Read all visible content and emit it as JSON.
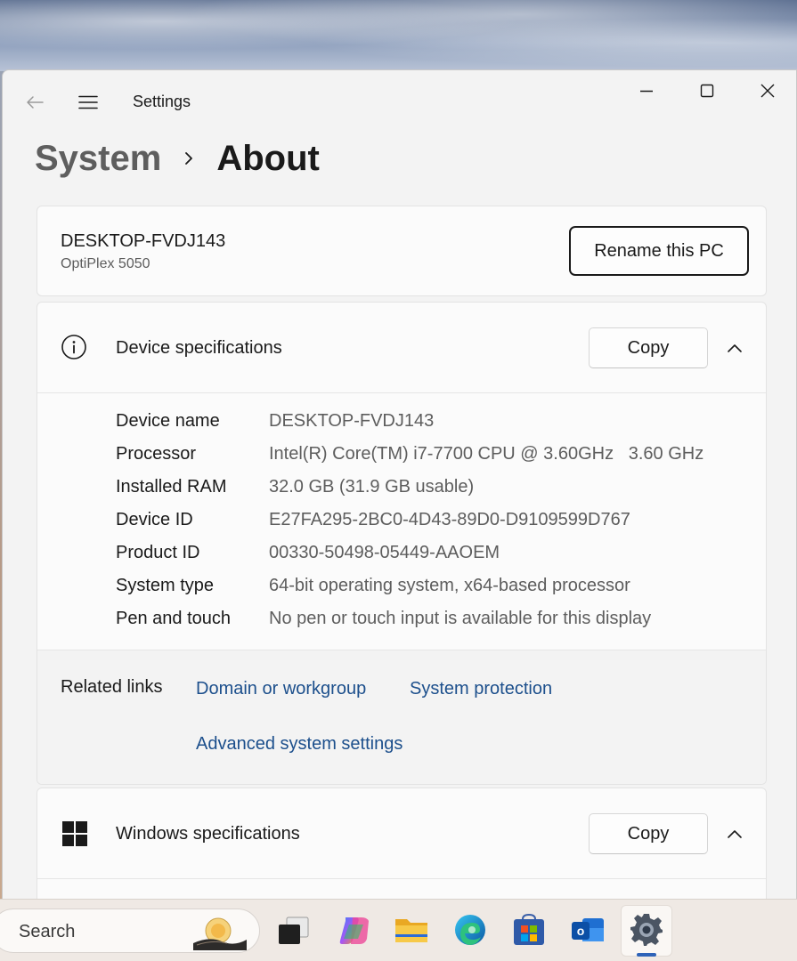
{
  "app": {
    "title": "Settings"
  },
  "breadcrumb": {
    "parent": "System",
    "current": "About"
  },
  "pc": {
    "name": "DESKTOP-FVDJ143",
    "model": "OptiPlex 5050",
    "rename_label": "Rename this PC"
  },
  "device_specs": {
    "title": "Device specifications",
    "copy_label": "Copy",
    "rows": [
      {
        "label": "Device name",
        "value": "DESKTOP-FVDJ143"
      },
      {
        "label": "Processor",
        "value": "Intel(R) Core(TM) i7-7700 CPU @ 3.60GHz   3.60 GHz"
      },
      {
        "label": "Installed RAM",
        "value": "32.0 GB (31.9 GB usable)"
      },
      {
        "label": "Device ID",
        "value": "E27FA295-2BC0-4D43-89D0-D9109599D767"
      },
      {
        "label": "Product ID",
        "value": "00330-50498-05449-AAOEM"
      },
      {
        "label": "System type",
        "value": "64-bit operating system, x64-based processor"
      },
      {
        "label": "Pen and touch",
        "value": "No pen or touch input is available for this display"
      }
    ],
    "related": {
      "label": "Related links",
      "links": [
        "Domain or workgroup",
        "System protection",
        "Advanced system settings"
      ]
    }
  },
  "windows_specs": {
    "title": "Windows specifications",
    "copy_label": "Copy"
  },
  "taskbar": {
    "search_label": "Search",
    "icons": [
      "task-view-icon",
      "copilot-icon",
      "file-explorer-icon",
      "edge-icon",
      "store-icon",
      "outlook-icon",
      "settings-icon"
    ]
  },
  "colors": {
    "link": "#1c4f8c",
    "accent": "#2e63b8",
    "window_bg": "#f3f3f3",
    "card_bg": "#fbfbfb"
  }
}
